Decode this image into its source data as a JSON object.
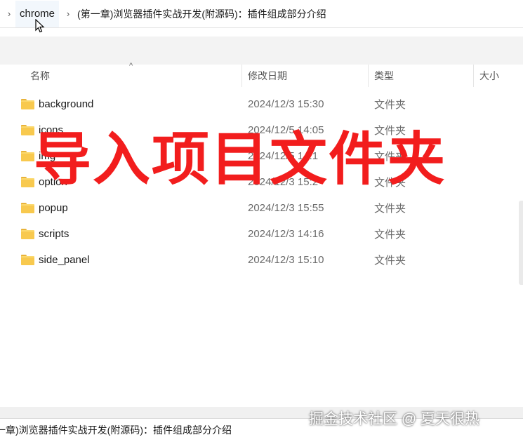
{
  "breadcrumb": {
    "items": [
      "chrome",
      "(第一章)浏览器插件实战开发(附源码)：插件组成部分介绍"
    ]
  },
  "columns": {
    "name": "名称",
    "modified": "修改日期",
    "type": "类型",
    "size": "大小"
  },
  "files": [
    {
      "name": "background",
      "modified": "2024/12/3 15:30",
      "type": "文件夹",
      "icon": "folder-icon"
    },
    {
      "name": "icons",
      "modified": "2024/12/5 14:05",
      "type": "文件夹",
      "icon": "folder-icon"
    },
    {
      "name": "img",
      "modified": "2024/12/5 14:1",
      "type": "文件夹",
      "icon": "folder-icon"
    },
    {
      "name": "option",
      "modified": "2024/12/3 15:2",
      "type": "文件夹",
      "icon": "folder-icon"
    },
    {
      "name": "popup",
      "modified": "2024/12/3 15:55",
      "type": "文件夹",
      "icon": "folder-icon"
    },
    {
      "name": "scripts",
      "modified": "2024/12/3 14:16",
      "type": "文件夹",
      "icon": "folder-icon"
    },
    {
      "name": "side_panel",
      "modified": "2024/12/3 15:10",
      "type": "文件夹",
      "icon": "folder-icon"
    }
  ],
  "overlay_text": "导入项目文件夹",
  "status_path": "一章)浏览器插件实战开发(附源码)：插件组成部分介绍",
  "watermark": "掘金技术社区 @ 夏天很热",
  "colors": {
    "overlay": "#f21d1d",
    "folder": "#f8c94e"
  }
}
